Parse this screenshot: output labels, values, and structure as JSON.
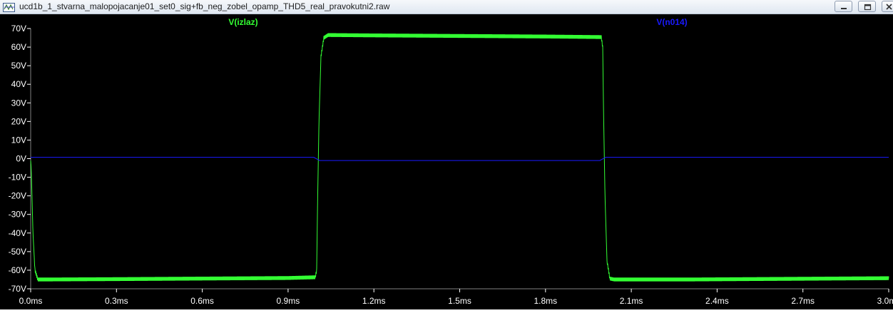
{
  "window": {
    "title": "ucd1b_1_stvarna_malopojacanje01_set0_sig+fb_neg_zobel_opamp_THD5_real_pravokutni2.raw"
  },
  "colors": {
    "plot_background": "#000000",
    "axis_text": "#ffffff",
    "grid": "#808080",
    "series_izlaz": "#33ff33",
    "series_n014": "#1a1aff"
  },
  "chart_data": {
    "type": "line",
    "title": "",
    "xlabel": "",
    "ylabel": "",
    "xlim": [
      0,
      3.0
    ],
    "ylim": [
      -70,
      70
    ],
    "x_ticks": [
      "0.0ms",
      "0.3ms",
      "0.6ms",
      "0.9ms",
      "1.2ms",
      "1.5ms",
      "1.8ms",
      "2.1ms",
      "2.4ms",
      "2.7ms",
      "3.0ms"
    ],
    "x_tick_values": [
      0,
      0.3,
      0.6,
      0.9,
      1.2,
      1.5,
      1.8,
      2.1,
      2.4,
      2.7,
      3.0
    ],
    "y_ticks": [
      "70V",
      "60V",
      "50V",
      "40V",
      "30V",
      "20V",
      "10V",
      "0V",
      "-10V",
      "-20V",
      "-30V",
      "-40V",
      "-50V",
      "-60V",
      "-70V"
    ],
    "y_tick_values": [
      70,
      60,
      50,
      40,
      30,
      20,
      10,
      0,
      -10,
      -20,
      -30,
      -40,
      -50,
      -60,
      -70
    ],
    "grid": false,
    "series": [
      {
        "name": "V(izlaz)",
        "color": "#33ff33",
        "x": [
          0,
          0.002,
          0.008,
          0.015,
          0.025,
          0.05,
          0.3,
          0.6,
          0.9,
          0.995,
          1.0,
          1.003,
          1.008,
          1.015,
          1.025,
          1.04,
          1.2,
          1.5,
          1.8,
          1.995,
          2.0,
          2.003,
          2.008,
          2.015,
          2.025,
          2.04,
          2.3,
          2.6,
          3.0
        ],
        "y": [
          -1,
          -5,
          -40,
          -60,
          -65,
          -65,
          -64.8,
          -64.5,
          -64.2,
          -63.8,
          -60,
          -25,
          20,
          55,
          65,
          66.5,
          66.3,
          66.0,
          65.7,
          65.4,
          60,
          25,
          -20,
          -55,
          -64.5,
          -65,
          -65.0,
          -64.7,
          -64.3
        ],
        "ripple": 1.0
      },
      {
        "name": "V(n014)",
        "color": "#1a1aff",
        "x": [
          0,
          0.99,
          1.01,
          1.99,
          2.01,
          3.0
        ],
        "y": [
          0.7,
          0.7,
          -1.0,
          -1.0,
          0.7,
          0.7
        ]
      }
    ]
  }
}
